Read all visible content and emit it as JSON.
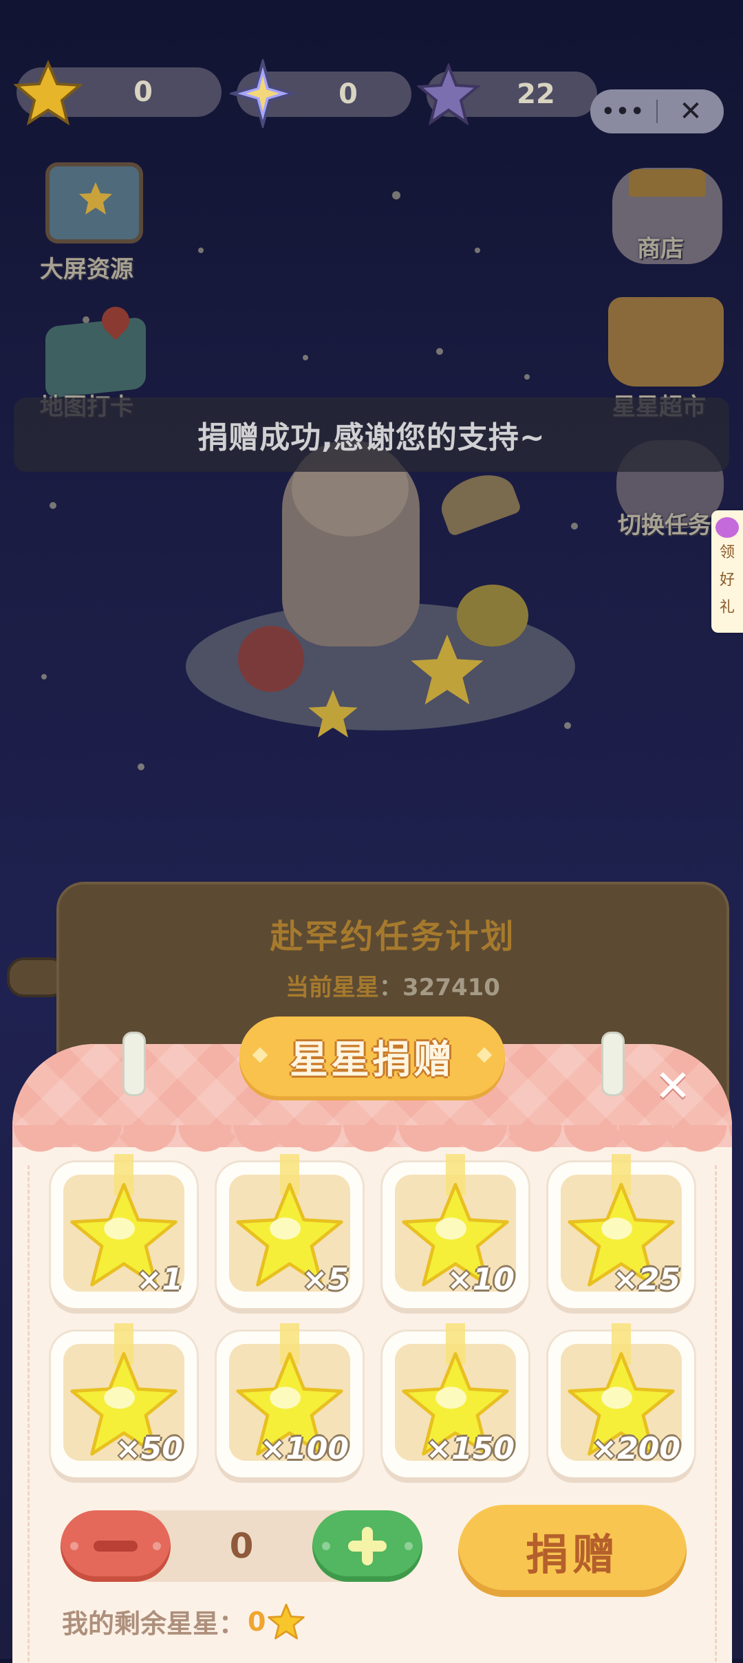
{
  "hud": {
    "gold_stars": "0",
    "sparkles": "0",
    "purple_stars": "22"
  },
  "capsule": {
    "more": "•••",
    "close": "✕"
  },
  "side_menu": {
    "left": [
      {
        "label": "大屏资源"
      },
      {
        "label": "地图打卡"
      }
    ],
    "right": [
      {
        "label": "商店"
      },
      {
        "label": "星星超市"
      },
      {
        "label": "切换任务"
      }
    ]
  },
  "toast": "捐赠成功,感谢您的支持~",
  "gift_tab": [
    "领",
    "好",
    "礼"
  ],
  "board": {
    "title": "赴罕约任务计划",
    "current_label": "当前星星",
    "current_value": "：327410"
  },
  "modal": {
    "title": "星星捐赠",
    "close": "✕",
    "options": [
      {
        "qty": "×1"
      },
      {
        "qty": "×5"
      },
      {
        "qty": "×10"
      },
      {
        "qty": "×25"
      },
      {
        "qty": "×50"
      },
      {
        "qty": "×100"
      },
      {
        "qty": "×150"
      },
      {
        "qty": "×200"
      }
    ],
    "quantity": "0",
    "donate_label": "捐赠",
    "remaining_label": "我的剩余星星：",
    "remaining_value": "0"
  },
  "colors": {
    "accent_yellow": "#f8c650",
    "minus_red": "#e4695a",
    "plus_green": "#52b760",
    "modal_pink": "#f4b1a5"
  }
}
